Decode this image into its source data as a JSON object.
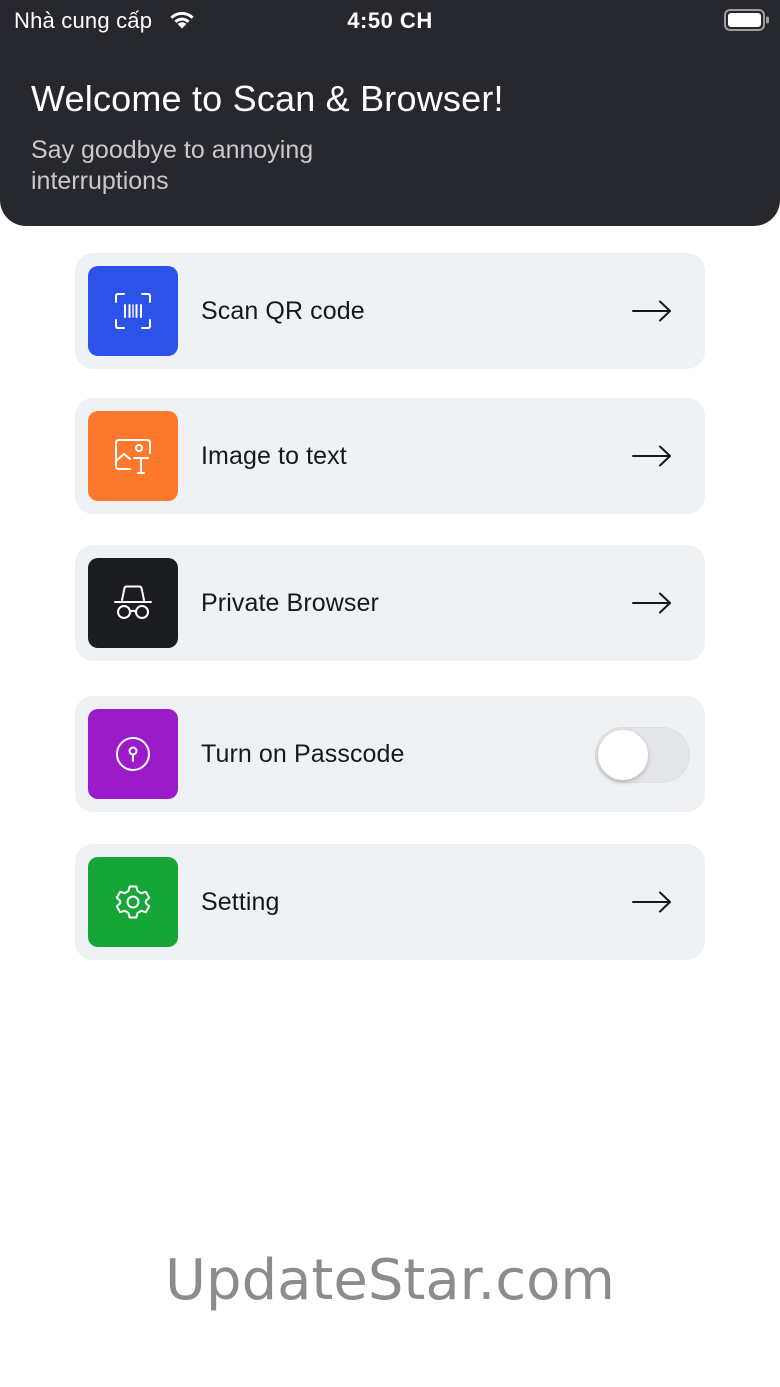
{
  "status_bar": {
    "carrier": "Nhà cung cấp",
    "time": "4:50 CH",
    "icons": [
      "wifi-icon",
      "battery-icon"
    ]
  },
  "header": {
    "title": "Welcome to Scan & Browser!",
    "subtitle": "Say goodbye to annoying interruptions",
    "background": "#27282d"
  },
  "menu": {
    "items": [
      {
        "label": "Scan QR code",
        "icon": "qr-scan-icon",
        "icon_color": "#2b53ea",
        "action": "arrow-right-icon"
      },
      {
        "label": "Image to text",
        "icon": "image-to-text-icon",
        "icon_color": "#fb782d",
        "action": "arrow-right-icon"
      },
      {
        "label": "Private Browser",
        "icon": "incognito-icon",
        "icon_color": "#1c1d21",
        "action": "arrow-right-icon"
      },
      {
        "label": "Turn on Passcode",
        "icon": "lock-icon",
        "icon_color": "#9b1bc9",
        "action": "toggle",
        "toggle_on": false
      },
      {
        "label": "Setting",
        "icon": "gear-icon",
        "icon_color": "#16a637",
        "action": "arrow-right-icon"
      }
    ],
    "card_background": "#eff2f5"
  },
  "watermark": "UpdateStar.com"
}
